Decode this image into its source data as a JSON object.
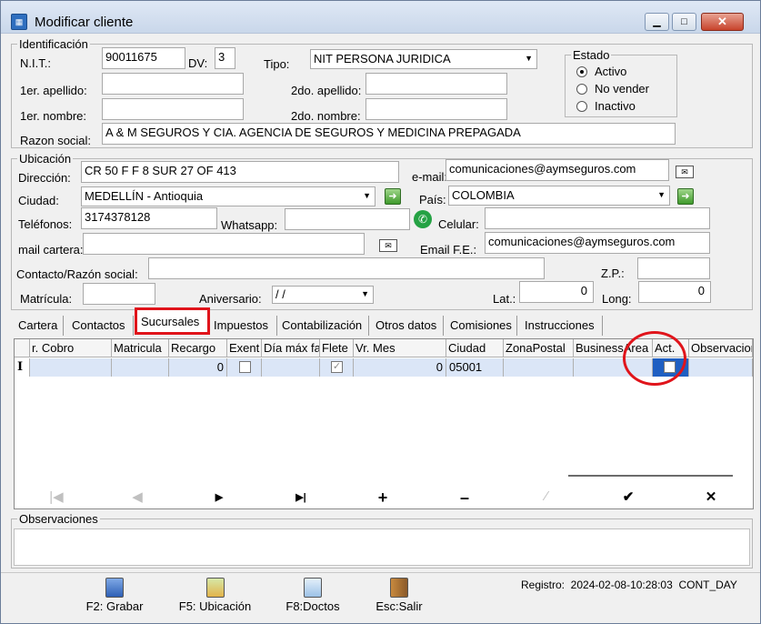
{
  "window": {
    "title": "Modificar cliente",
    "icon": "app-icon"
  },
  "identificacion": {
    "legend": "Identificación",
    "nit_label": "N.I.T.:",
    "nit_value": "90011675",
    "dv_label": "DV:",
    "dv_value": "3",
    "tipo_label": "Tipo:",
    "tipo_value": "NIT PERSONA JURIDICA",
    "apellido1_label": "1er. apellido:",
    "apellido1_value": "",
    "apellido2_label": "2do. apellido:",
    "apellido2_value": "",
    "nombre1_label": "1er. nombre:",
    "nombre1_value": "",
    "nombre2_label": "2do. nombre:",
    "nombre2_value": "",
    "razon_label": "Razon social:",
    "razon_value": "A & M SEGUROS Y CIA. AGENCIA DE SEGUROS Y MEDICINA PREPAGADA"
  },
  "estado": {
    "legend": "Estado",
    "options": [
      "Activo",
      "No vender",
      "Inactivo"
    ],
    "selected": "Activo"
  },
  "ubicacion": {
    "legend": "Ubicación",
    "direccion_label": "Dirección:",
    "direccion_value": "CR 50 F F 8 SUR 27 OF 413",
    "email_label": "e-mail:",
    "email_value": "comunicaciones@aymseguros.com",
    "ciudad_label": "Ciudad:",
    "ciudad_value": "MEDELLÍN - Antioquia",
    "pais_label": "País:",
    "pais_value": "COLOMBIA",
    "telefonos_label": "Teléfonos:",
    "telefonos_value": "3174378128",
    "whatsapp_label": "Whatsapp:",
    "whatsapp_value": "",
    "celular_label": "Celular:",
    "celular_value": "",
    "mail_cartera_label": "mail cartera:",
    "mail_cartera_value": "",
    "email_fe_label": "Email F.E.:",
    "email_fe_value": "comunicaciones@aymseguros.com",
    "contacto_label": "Contacto/Razón social:",
    "contacto_value": "",
    "zp_label": "Z.P.:",
    "zp_value": "",
    "matricula_label": "Matrícula:",
    "matricula_value": "",
    "aniversario_label": "Aniversario:",
    "aniversario_value": " / /",
    "lat_label": "Lat.:",
    "lat_value": "0",
    "long_label": "Long:",
    "long_value": "0"
  },
  "tabs": [
    "Cartera",
    "Contactos",
    "Sucursales",
    "Impuestos",
    "Contabilización",
    "Otros datos",
    "Comisiones",
    "Instrucciones"
  ],
  "active_tab": "Sucursales",
  "grid": {
    "columns": [
      "r. Cobro",
      "Matricula",
      "Recargo",
      "Exent",
      "Día máx fa",
      "Flete",
      "Vr. Mes",
      "Ciudad",
      "ZonaPostal",
      "BusinessArea",
      "Act.",
      "Observacion"
    ],
    "row": {
      "cobro": "",
      "matricula": "",
      "recargo": "0",
      "exent": false,
      "dia": "",
      "flete": true,
      "vr_mes": "0",
      "ciudad": "05001",
      "zona": "",
      "business": "",
      "act": false,
      "obs": ""
    },
    "row_cursor": "I"
  },
  "navigator": [
    "first",
    "prior",
    "next",
    "last",
    "insert",
    "delete",
    "edit",
    "post",
    "cancel"
  ],
  "observaciones": {
    "legend": "Observaciones",
    "value": ""
  },
  "buttons": [
    {
      "label": "F2: Grabar",
      "icon": "save-icon"
    },
    {
      "label": "F5: Ubicación",
      "icon": "map-icon"
    },
    {
      "label": "F8:Doctos",
      "icon": "document-icon"
    },
    {
      "label": "Esc:Salir",
      "icon": "exit-door-icon"
    }
  ],
  "registro": "Registro:  2024-02-08-10:28:03  CONT_DAY",
  "colors": {
    "highlight": "#e0141b",
    "selected_row": "#dbe6f7"
  }
}
